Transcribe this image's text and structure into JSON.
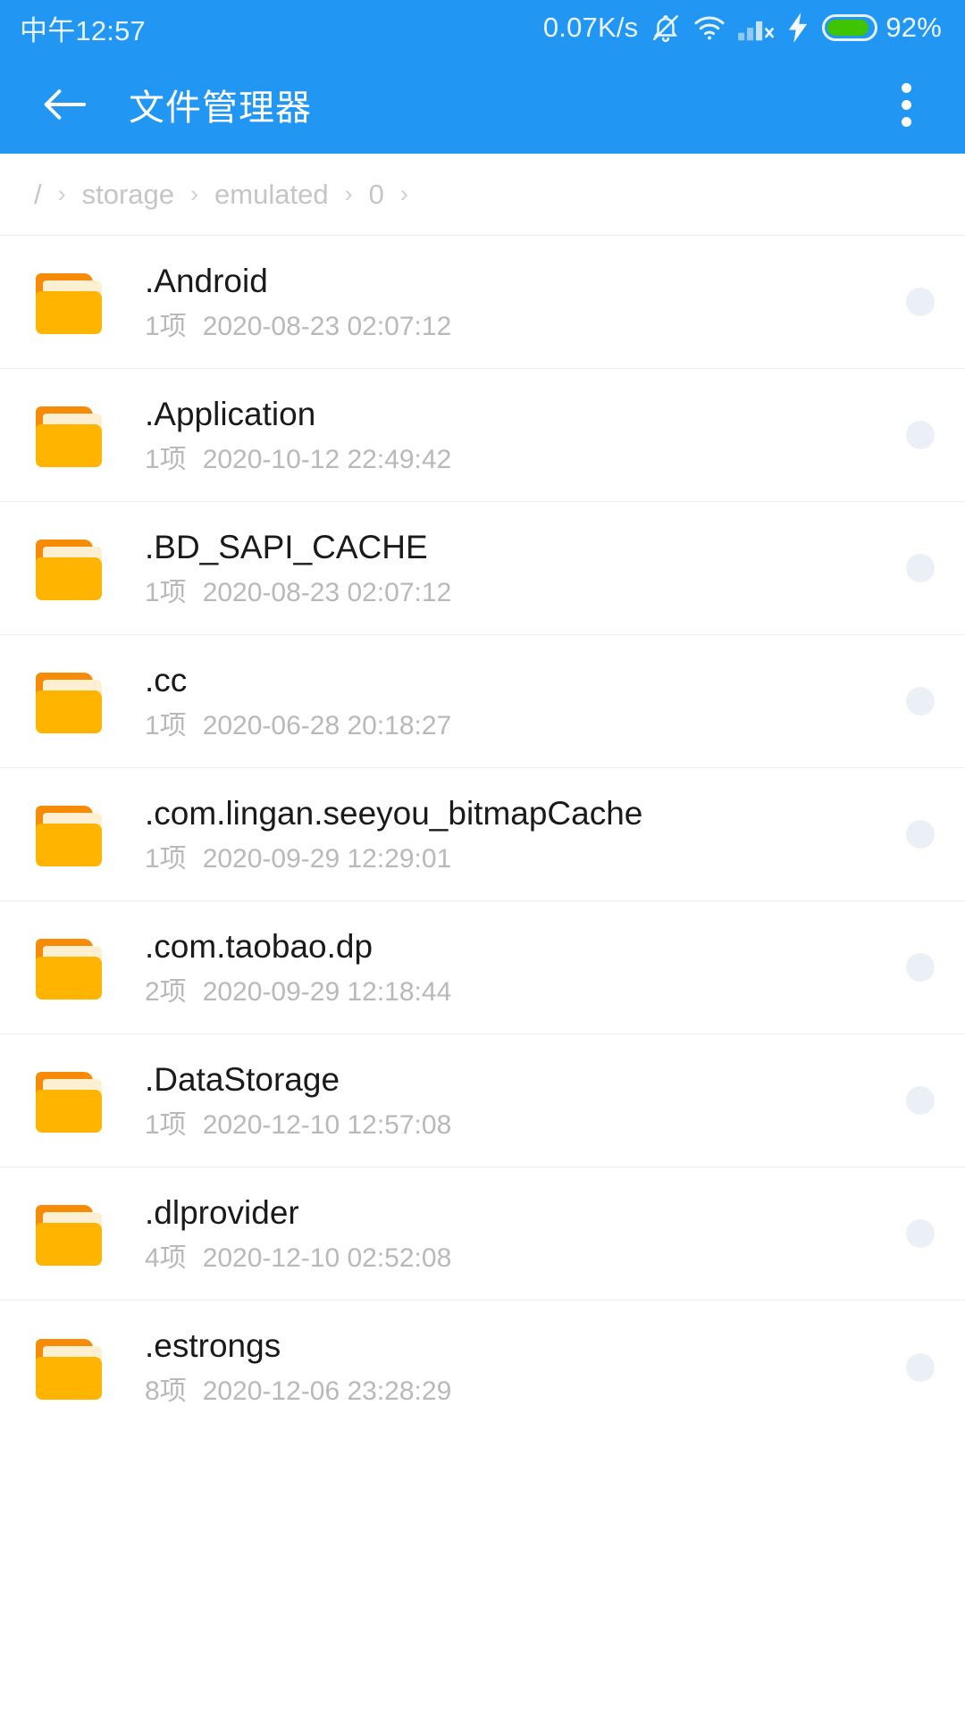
{
  "theme": {
    "accent": "#2196f3",
    "folder_front": "#ffb400",
    "folder_back": "#f68b07",
    "folder_paper": "#fdf0d2",
    "battery_green": "#3ec400",
    "selector_dot": "#ebeff6"
  },
  "statusbar": {
    "time": "中午12:57",
    "network_speed": "0.07K/s",
    "icons": [
      "bell-muted-icon",
      "wifi-icon",
      "signal-no-service-icon",
      "charging-bolt-icon"
    ],
    "battery_percent": "92%",
    "battery_level": 92
  },
  "appbar": {
    "back_icon": "arrow-left-icon",
    "title": "文件管理器",
    "overflow_icon": "overflow-menu-icon"
  },
  "breadcrumb": {
    "separator": "›",
    "segments": [
      "/",
      "storage",
      "emulated",
      "0"
    ],
    "trailing_separator": "›"
  },
  "files": [
    {
      "icon": "folder-icon",
      "name": ".Android",
      "count": "1项",
      "modified": "2020-08-23 02:07:12",
      "selected": false
    },
    {
      "icon": "folder-icon",
      "name": ".Application",
      "count": "1项",
      "modified": "2020-10-12 22:49:42",
      "selected": false
    },
    {
      "icon": "folder-icon",
      "name": ".BD_SAPI_CACHE",
      "count": "1项",
      "modified": "2020-08-23 02:07:12",
      "selected": false
    },
    {
      "icon": "folder-icon",
      "name": ".cc",
      "count": "1项",
      "modified": "2020-06-28 20:18:27",
      "selected": false
    },
    {
      "icon": "folder-icon",
      "name": ".com.lingan.seeyou_bitmapCache",
      "count": "1项",
      "modified": "2020-09-29 12:29:01",
      "selected": false
    },
    {
      "icon": "folder-icon",
      "name": ".com.taobao.dp",
      "count": "2项",
      "modified": "2020-09-29 12:18:44",
      "selected": false
    },
    {
      "icon": "folder-icon",
      "name": ".DataStorage",
      "count": "1项",
      "modified": "2020-12-10 12:57:08",
      "selected": false
    },
    {
      "icon": "folder-icon",
      "name": ".dlprovider",
      "count": "4项",
      "modified": "2020-12-10 02:52:08",
      "selected": false
    },
    {
      "icon": "folder-icon",
      "name": ".estrongs",
      "count": "8项",
      "modified": "2020-12-06 23:28:29",
      "selected": false
    }
  ]
}
